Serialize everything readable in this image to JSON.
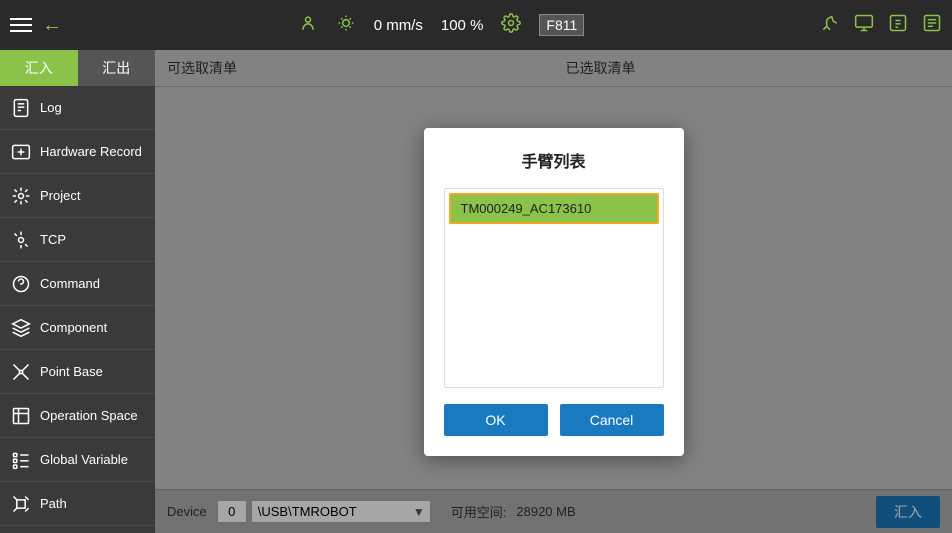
{
  "topbar": {
    "speed": "0 mm/s",
    "percent": "100 %",
    "fcode": "F811"
  },
  "sidebar": {
    "tab_import": "汇入",
    "tab_export": "汇出",
    "items": [
      {
        "id": "log",
        "label": "Log",
        "icon": "log-icon"
      },
      {
        "id": "hardware-record",
        "label": "Hardware Record",
        "icon": "hardware-icon"
      },
      {
        "id": "project",
        "label": "Project",
        "icon": "project-icon"
      },
      {
        "id": "tcp",
        "label": "TCP",
        "icon": "tcp-icon"
      },
      {
        "id": "command",
        "label": "Command",
        "icon": "command-icon"
      },
      {
        "id": "component",
        "label": "Component",
        "icon": "component-icon"
      },
      {
        "id": "point-base",
        "label": "Point Base",
        "icon": "point-icon"
      },
      {
        "id": "operation-space",
        "label": "Operation Space",
        "icon": "operation-icon"
      },
      {
        "id": "global-variable",
        "label": "Global Variable",
        "icon": "variable-icon"
      },
      {
        "id": "path",
        "label": "Path",
        "icon": "path-icon"
      }
    ]
  },
  "content": {
    "col1": "可选取清单",
    "col2": "已选取清单"
  },
  "modal": {
    "title": "手臂列表",
    "items": [
      {
        "id": "TM000249_AC173610",
        "label": "TM000249_AC173610",
        "selected": true
      }
    ],
    "ok_label": "OK",
    "cancel_label": "Cancel"
  },
  "bottom": {
    "device_label": "Device",
    "device_num": "0",
    "device_path": "\\USB\\TMROBOT",
    "space_label": "可用空间:",
    "space_value": "28920 MB",
    "import_btn": "汇入"
  }
}
